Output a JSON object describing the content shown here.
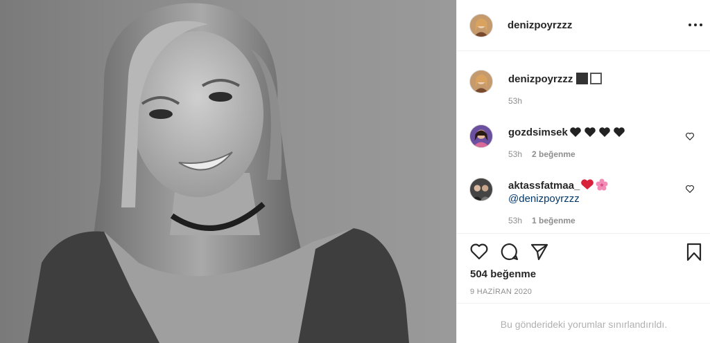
{
  "post": {
    "username": "denizpoyrzzz"
  },
  "caption": {
    "username": "denizpoyrzzz",
    "time": "53h"
  },
  "comments": [
    {
      "username": "gozdsimsek",
      "time": "53h",
      "likes": "2 beğenme"
    },
    {
      "username": "aktassfatmaa_",
      "mention": "@denizpoyrzzz",
      "time": "53h",
      "likes": "1 beğenme"
    }
  ],
  "stats": {
    "likes": "504 beğenme",
    "date": "9 HAZİRAN 2020"
  },
  "footer": {
    "restricted_text": "Bu gönderideki yorumlar sınırlandırıldı."
  },
  "icons": {
    "more": "more-options-icon",
    "like": "heart-icon",
    "comment": "comment-icon",
    "share": "share-icon",
    "save": "bookmark-icon"
  }
}
